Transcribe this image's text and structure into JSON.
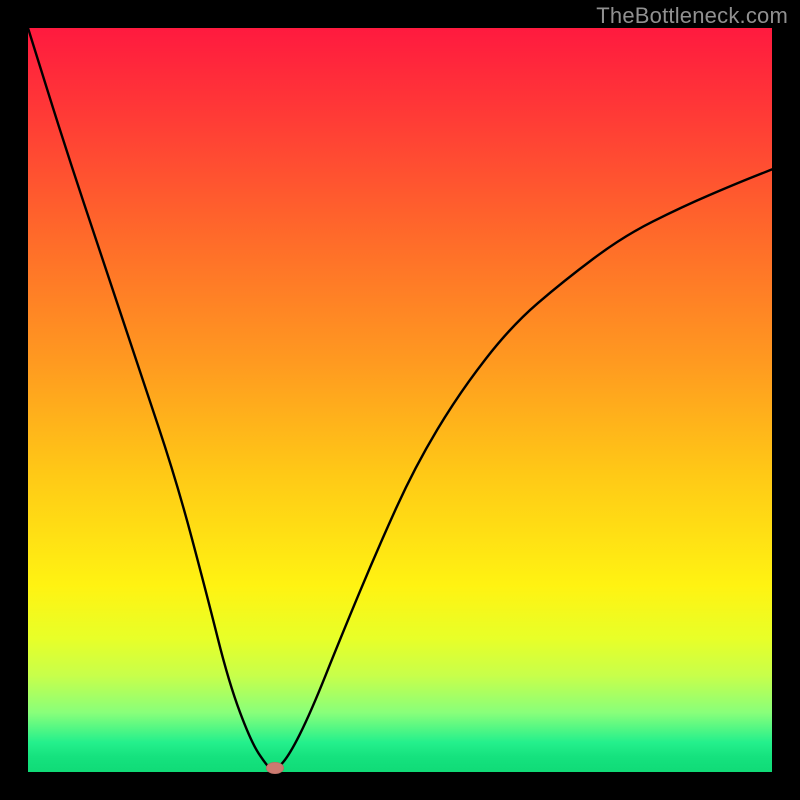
{
  "watermark": "TheBottleneck.com",
  "chart_data": {
    "type": "line",
    "title": "",
    "xlabel": "",
    "ylabel": "",
    "xlim": [
      0,
      100
    ],
    "ylim": [
      0,
      100
    ],
    "grid": false,
    "legend": false,
    "background_gradient": [
      "#ff1a3f",
      "#ff9a20",
      "#fff312",
      "#10db77"
    ],
    "series": [
      {
        "name": "curve",
        "x": [
          0,
          5,
          10,
          15,
          20,
          24,
          27,
          30,
          32,
          33,
          35,
          38,
          42,
          47,
          52,
          58,
          65,
          72,
          80,
          88,
          95,
          100
        ],
        "values": [
          100,
          84,
          69,
          54,
          39,
          24,
          12,
          4,
          1,
          0,
          2,
          8,
          18,
          30,
          41,
          51,
          60,
          66,
          72,
          76,
          79,
          81
        ]
      }
    ],
    "marker": {
      "x": 33.2,
      "y": 0.5,
      "color": "#cc7a70"
    }
  }
}
